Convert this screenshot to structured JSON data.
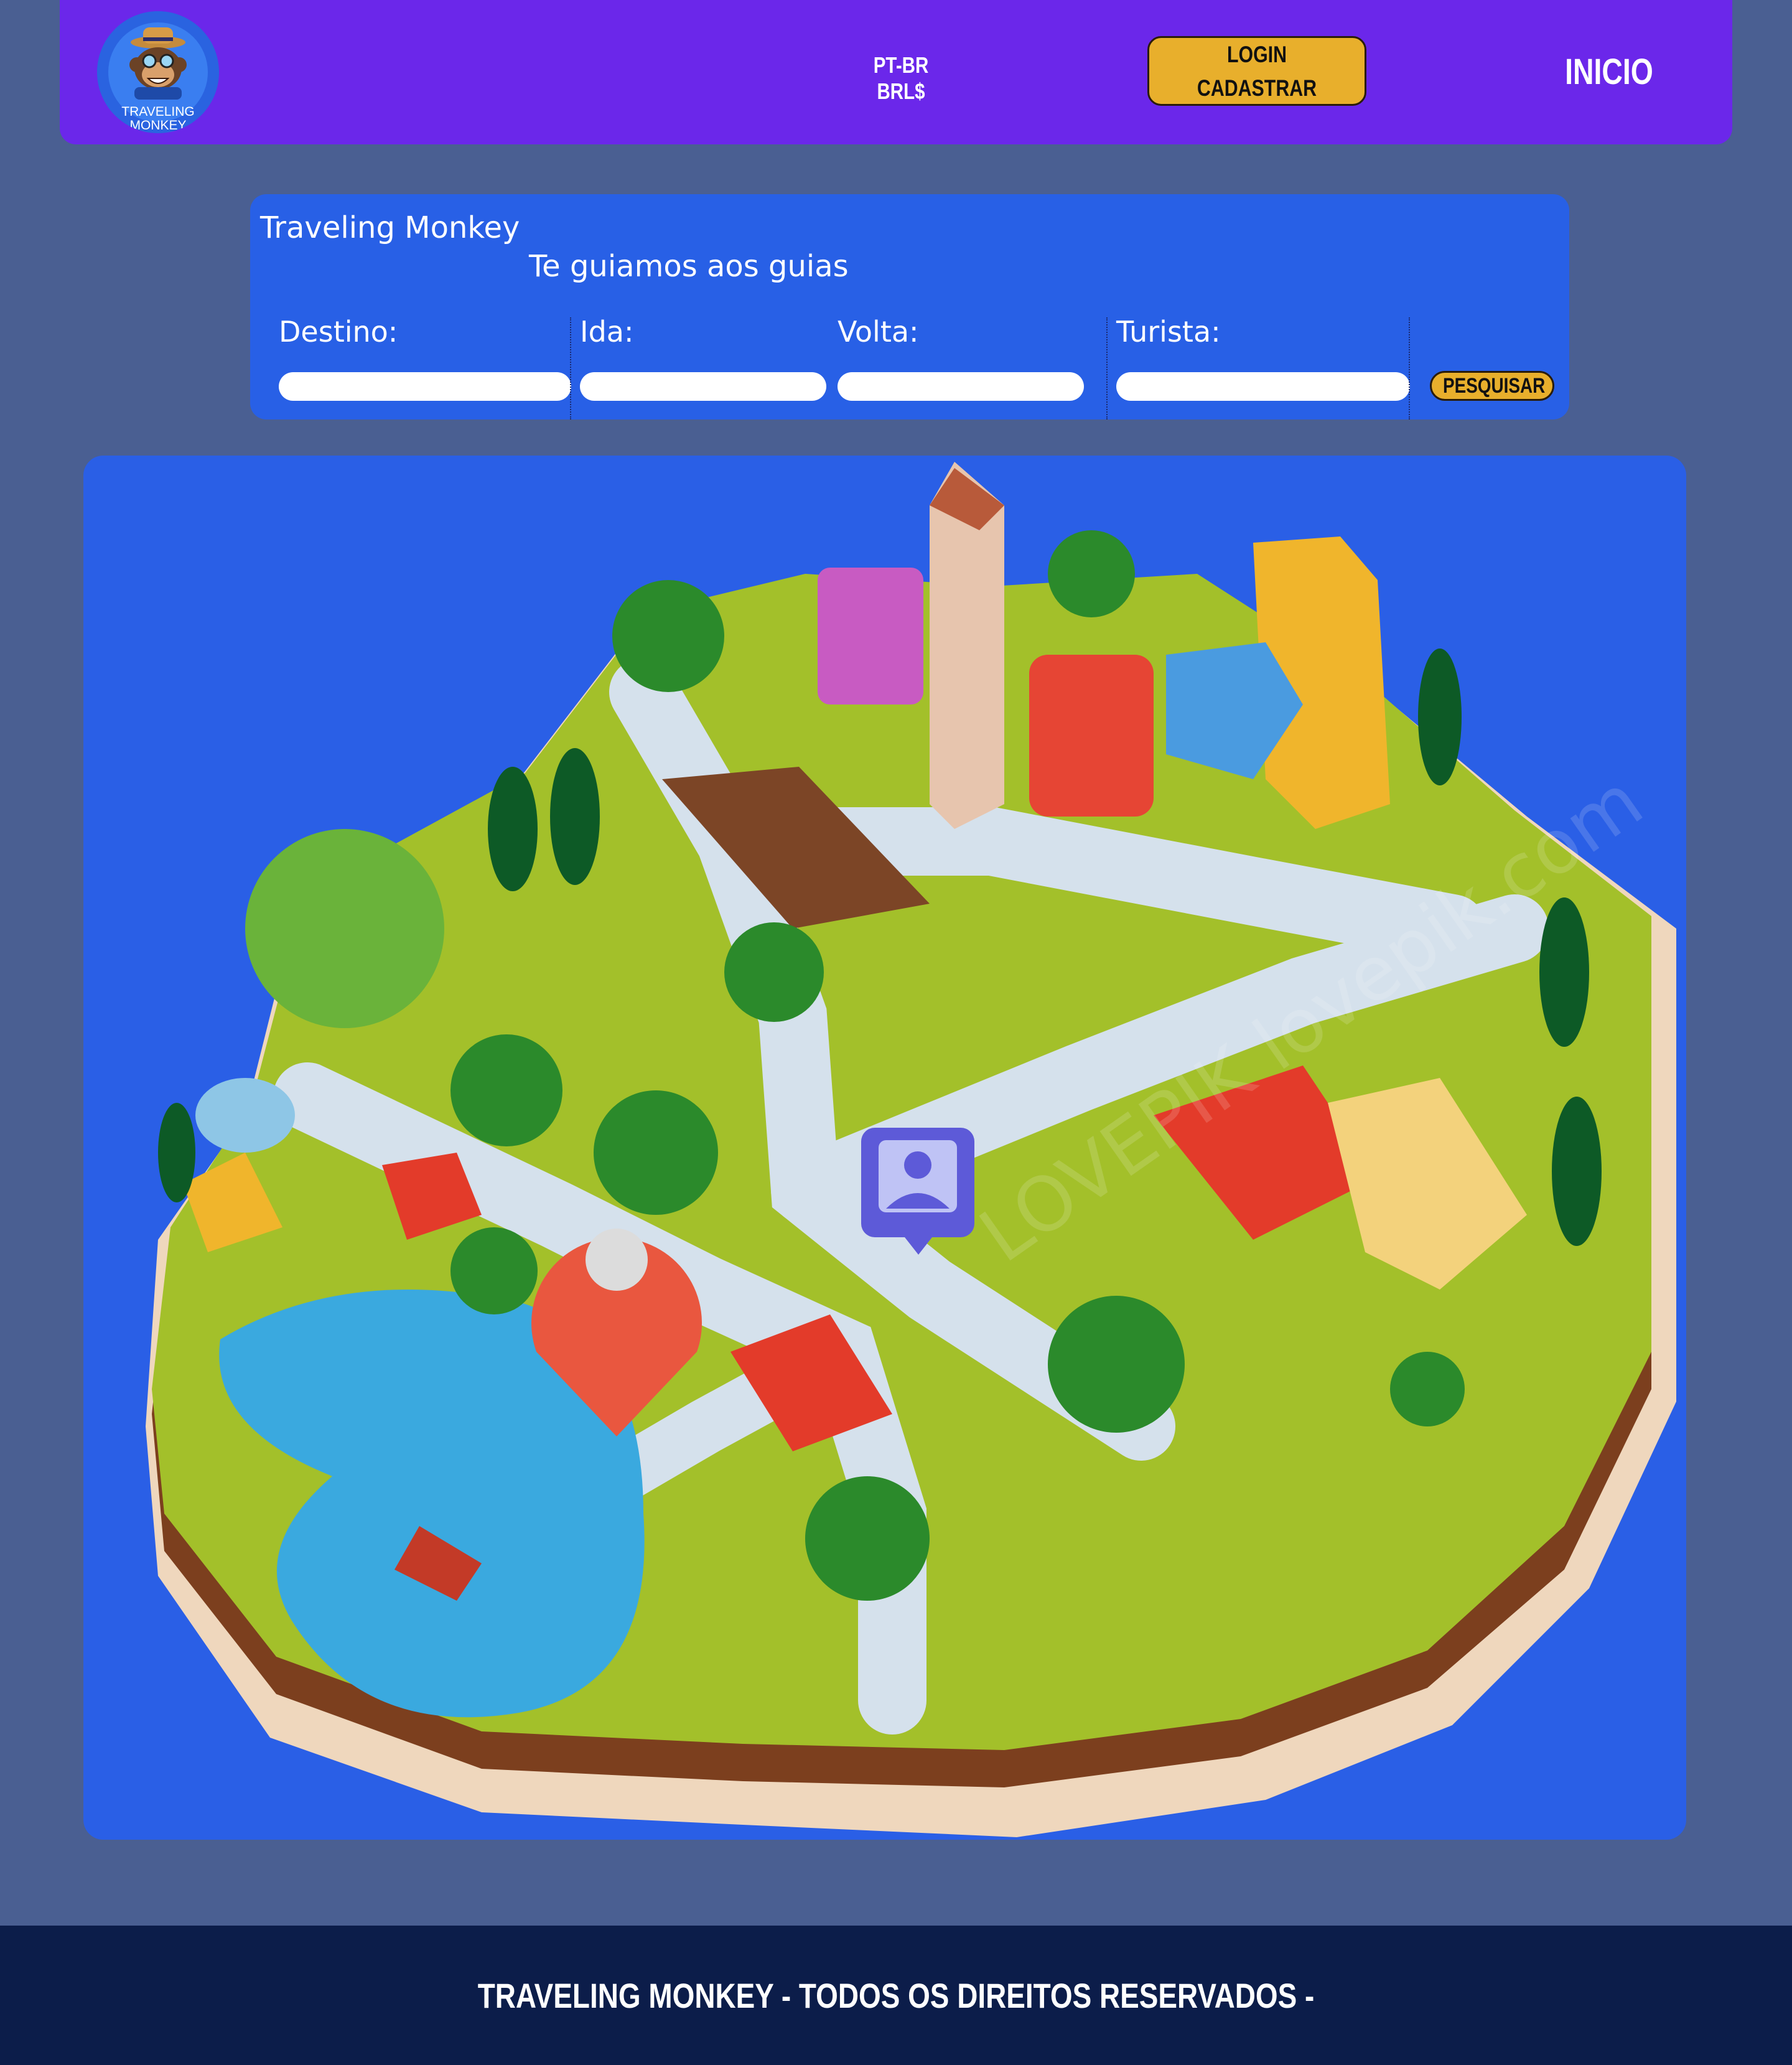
{
  "header": {
    "logo_line1": "TRAVELING",
    "logo_line2": "MONKEY",
    "language_currency": "PT-BR BRL$",
    "login_line1": "LOGIN",
    "login_line2": "CADASTRAR",
    "nav_home": "INICIO"
  },
  "search": {
    "title": "Traveling Monkey",
    "subtitle": "Te guiamos aos guias",
    "fields": [
      {
        "label": "Destino:",
        "value": ""
      },
      {
        "label": "Ida:",
        "value": ""
      },
      {
        "label": "Volta:",
        "value": ""
      },
      {
        "label": "Turista:",
        "value": ""
      }
    ],
    "button": "PESQUISAR"
  },
  "map": {
    "icons": [
      "location-pin-icon",
      "guide-profile-icon"
    ],
    "watermark": "LOVEPIK lovepik.com"
  },
  "footer": {
    "text": "TRAVELING MONKEY - TODOS OS DIREITOS RESERVADOS -"
  },
  "colors": {
    "header_bg": "#6b27ea",
    "page_bg": "#4a5f92",
    "panel_bg": "#2860e6",
    "button_accent": "#e8af2c",
    "footer_bg": "#0c1d4a",
    "pin_red": "#e9573f",
    "profile_purple": "#5d5ad8"
  }
}
